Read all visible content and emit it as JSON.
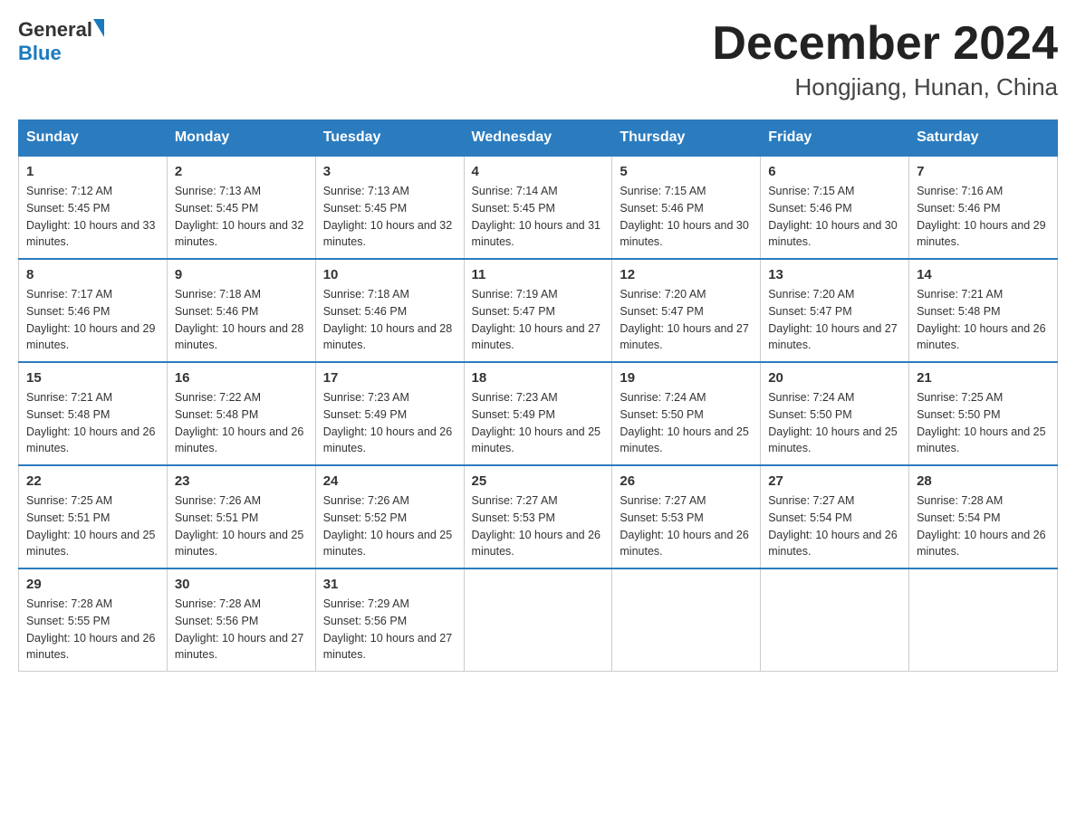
{
  "header": {
    "logo_general": "General",
    "logo_blue": "Blue",
    "month_title": "December 2024",
    "location": "Hongjiang, Hunan, China"
  },
  "weekdays": [
    "Sunday",
    "Monday",
    "Tuesday",
    "Wednesday",
    "Thursday",
    "Friday",
    "Saturday"
  ],
  "weeks": [
    [
      {
        "day": "1",
        "sunrise": "7:12 AM",
        "sunset": "5:45 PM",
        "daylight": "10 hours and 33 minutes."
      },
      {
        "day": "2",
        "sunrise": "7:13 AM",
        "sunset": "5:45 PM",
        "daylight": "10 hours and 32 minutes."
      },
      {
        "day": "3",
        "sunrise": "7:13 AM",
        "sunset": "5:45 PM",
        "daylight": "10 hours and 32 minutes."
      },
      {
        "day": "4",
        "sunrise": "7:14 AM",
        "sunset": "5:45 PM",
        "daylight": "10 hours and 31 minutes."
      },
      {
        "day": "5",
        "sunrise": "7:15 AM",
        "sunset": "5:46 PM",
        "daylight": "10 hours and 30 minutes."
      },
      {
        "day": "6",
        "sunrise": "7:15 AM",
        "sunset": "5:46 PM",
        "daylight": "10 hours and 30 minutes."
      },
      {
        "day": "7",
        "sunrise": "7:16 AM",
        "sunset": "5:46 PM",
        "daylight": "10 hours and 29 minutes."
      }
    ],
    [
      {
        "day": "8",
        "sunrise": "7:17 AM",
        "sunset": "5:46 PM",
        "daylight": "10 hours and 29 minutes."
      },
      {
        "day": "9",
        "sunrise": "7:18 AM",
        "sunset": "5:46 PM",
        "daylight": "10 hours and 28 minutes."
      },
      {
        "day": "10",
        "sunrise": "7:18 AM",
        "sunset": "5:46 PM",
        "daylight": "10 hours and 28 minutes."
      },
      {
        "day": "11",
        "sunrise": "7:19 AM",
        "sunset": "5:47 PM",
        "daylight": "10 hours and 27 minutes."
      },
      {
        "day": "12",
        "sunrise": "7:20 AM",
        "sunset": "5:47 PM",
        "daylight": "10 hours and 27 minutes."
      },
      {
        "day": "13",
        "sunrise": "7:20 AM",
        "sunset": "5:47 PM",
        "daylight": "10 hours and 27 minutes."
      },
      {
        "day": "14",
        "sunrise": "7:21 AM",
        "sunset": "5:48 PM",
        "daylight": "10 hours and 26 minutes."
      }
    ],
    [
      {
        "day": "15",
        "sunrise": "7:21 AM",
        "sunset": "5:48 PM",
        "daylight": "10 hours and 26 minutes."
      },
      {
        "day": "16",
        "sunrise": "7:22 AM",
        "sunset": "5:48 PM",
        "daylight": "10 hours and 26 minutes."
      },
      {
        "day": "17",
        "sunrise": "7:23 AM",
        "sunset": "5:49 PM",
        "daylight": "10 hours and 26 minutes."
      },
      {
        "day": "18",
        "sunrise": "7:23 AM",
        "sunset": "5:49 PM",
        "daylight": "10 hours and 25 minutes."
      },
      {
        "day": "19",
        "sunrise": "7:24 AM",
        "sunset": "5:50 PM",
        "daylight": "10 hours and 25 minutes."
      },
      {
        "day": "20",
        "sunrise": "7:24 AM",
        "sunset": "5:50 PM",
        "daylight": "10 hours and 25 minutes."
      },
      {
        "day": "21",
        "sunrise": "7:25 AM",
        "sunset": "5:50 PM",
        "daylight": "10 hours and 25 minutes."
      }
    ],
    [
      {
        "day": "22",
        "sunrise": "7:25 AM",
        "sunset": "5:51 PM",
        "daylight": "10 hours and 25 minutes."
      },
      {
        "day": "23",
        "sunrise": "7:26 AM",
        "sunset": "5:51 PM",
        "daylight": "10 hours and 25 minutes."
      },
      {
        "day": "24",
        "sunrise": "7:26 AM",
        "sunset": "5:52 PM",
        "daylight": "10 hours and 25 minutes."
      },
      {
        "day": "25",
        "sunrise": "7:27 AM",
        "sunset": "5:53 PM",
        "daylight": "10 hours and 26 minutes."
      },
      {
        "day": "26",
        "sunrise": "7:27 AM",
        "sunset": "5:53 PM",
        "daylight": "10 hours and 26 minutes."
      },
      {
        "day": "27",
        "sunrise": "7:27 AM",
        "sunset": "5:54 PM",
        "daylight": "10 hours and 26 minutes."
      },
      {
        "day": "28",
        "sunrise": "7:28 AM",
        "sunset": "5:54 PM",
        "daylight": "10 hours and 26 minutes."
      }
    ],
    [
      {
        "day": "29",
        "sunrise": "7:28 AM",
        "sunset": "5:55 PM",
        "daylight": "10 hours and 26 minutes."
      },
      {
        "day": "30",
        "sunrise": "7:28 AM",
        "sunset": "5:56 PM",
        "daylight": "10 hours and 27 minutes."
      },
      {
        "day": "31",
        "sunrise": "7:29 AM",
        "sunset": "5:56 PM",
        "daylight": "10 hours and 27 minutes."
      },
      null,
      null,
      null,
      null
    ]
  ]
}
